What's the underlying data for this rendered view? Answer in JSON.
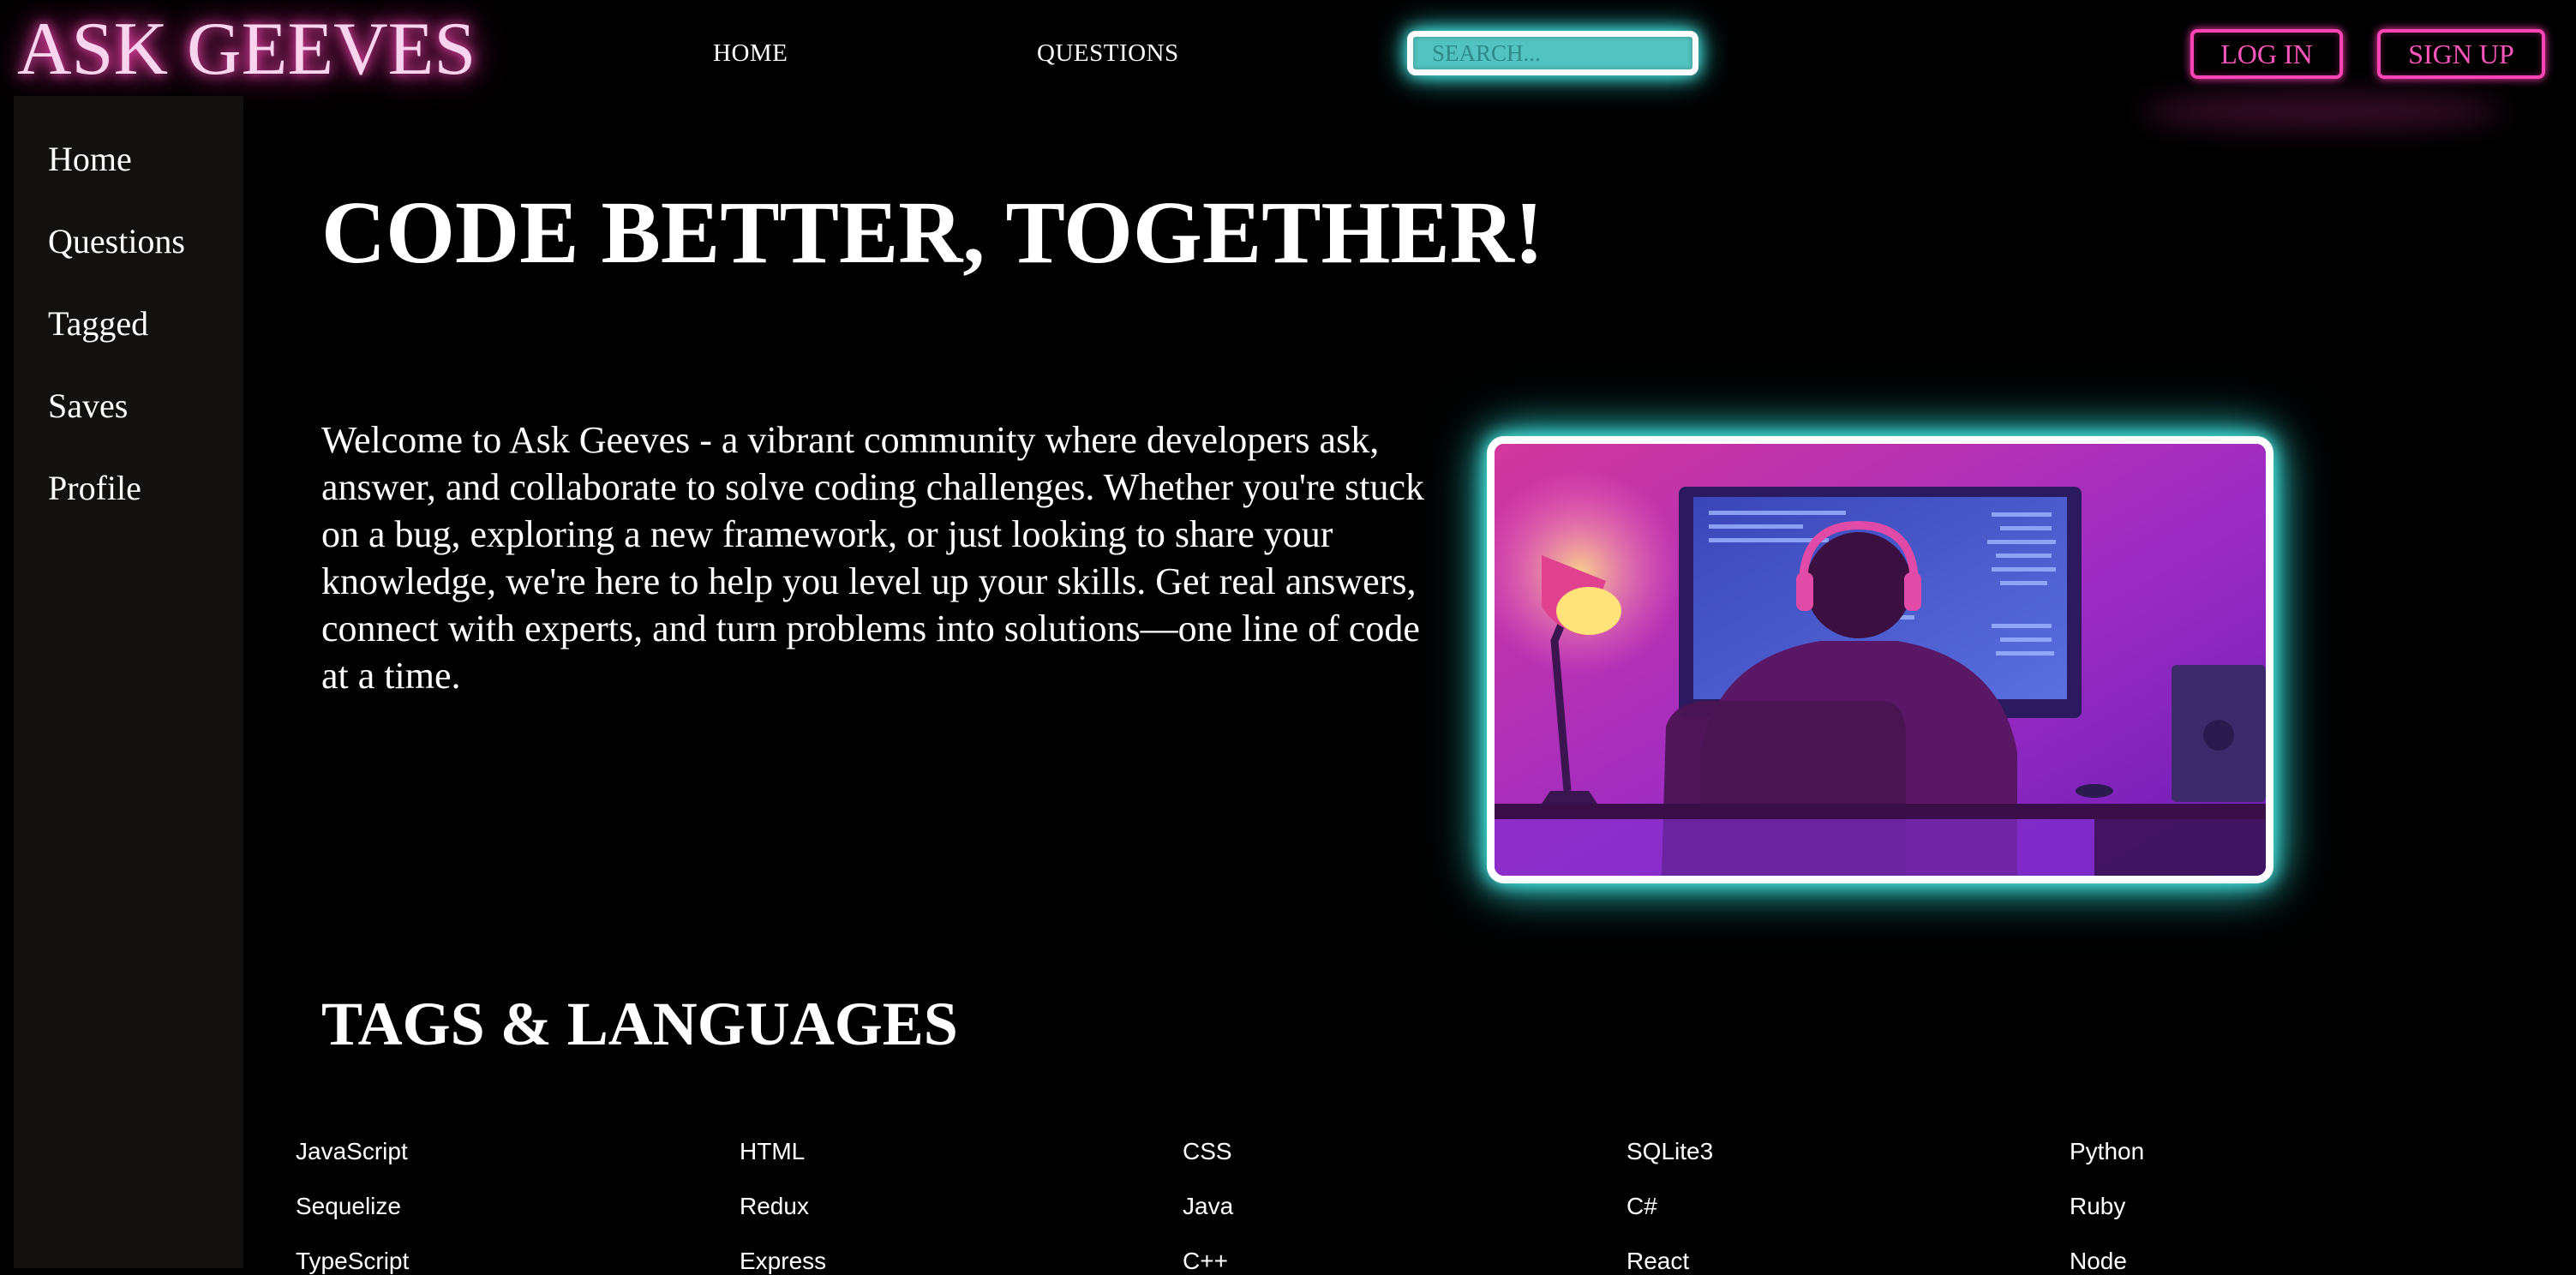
{
  "header": {
    "logo": "ASK GEEVES",
    "nav": [
      {
        "label": "HOME"
      },
      {
        "label": "QUESTIONS"
      }
    ],
    "search_placeholder": "SEARCH...",
    "login_label": "LOG IN",
    "signup_label": "SIGN UP"
  },
  "sidebar": {
    "items": [
      {
        "label": "Home"
      },
      {
        "label": "Questions"
      },
      {
        "label": "Tagged"
      },
      {
        "label": "Saves"
      },
      {
        "label": "Profile"
      }
    ]
  },
  "main": {
    "title": "CODE BETTER, TOGETHER!",
    "intro": "Welcome to Ask Geeves - a vibrant community where developers ask, answer, and collaborate to solve coding challenges. Whether you're stuck on a bug, exploring a new framework, or just looking to share your knowledge, we're here to help you level up your skills. Get real answers, connect with experts, and turn problems into solutions—one line of code at a time.",
    "tags_title": "TAGS & LANGUAGES",
    "tags": [
      [
        "JavaScript",
        "HTML",
        "CSS",
        "SQLite3",
        "Python"
      ],
      [
        "Sequelize",
        "Redux",
        "Java",
        "C#",
        "Ruby"
      ],
      [
        "TypeScript",
        "Express",
        "C++",
        "React",
        "Node"
      ]
    ]
  },
  "colors": {
    "background": "#000000",
    "neon_pink": "#ff45b5",
    "neon_cyan": "#4ef0ea",
    "sidebar_bg": "#121110"
  }
}
